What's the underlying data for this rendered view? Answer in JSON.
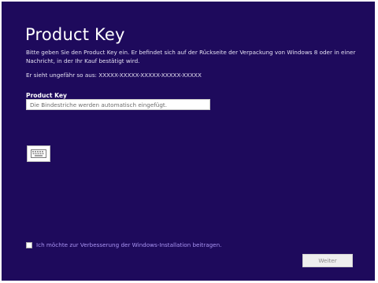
{
  "dialog": {
    "title": "Product Key",
    "description": "Bitte geben Sie den Product Key ein. Er befindet sich auf der Rückseite der Verpackung von Windows 8 oder in einer Nachricht, in der Ihr Kauf bestätigt wird.",
    "example": "Er sieht ungefähr so aus: XXXXX-XXXXX-XXXXX-XXXXX-XXXXX",
    "key_field": {
      "label": "Product Key",
      "value": "",
      "placeholder": "Die Bindestriche werden automatisch eingefügt."
    },
    "keyboard_button": {
      "icon": "keyboard-icon"
    },
    "improvement_checkbox": {
      "label": "Ich möchte zur Verbesserung der Windows-Installation beitragen.",
      "checked": false
    },
    "next_button": {
      "label": "Weiter",
      "enabled": false
    }
  },
  "colors": {
    "background": "#1e0a5c",
    "title_text": "#ffffff",
    "body_text": "#e4e0f2",
    "checkbox_label": "#a994f2",
    "button_disabled_bg": "#eeeeee",
    "button_disabled_text": "#8c8c8c"
  }
}
